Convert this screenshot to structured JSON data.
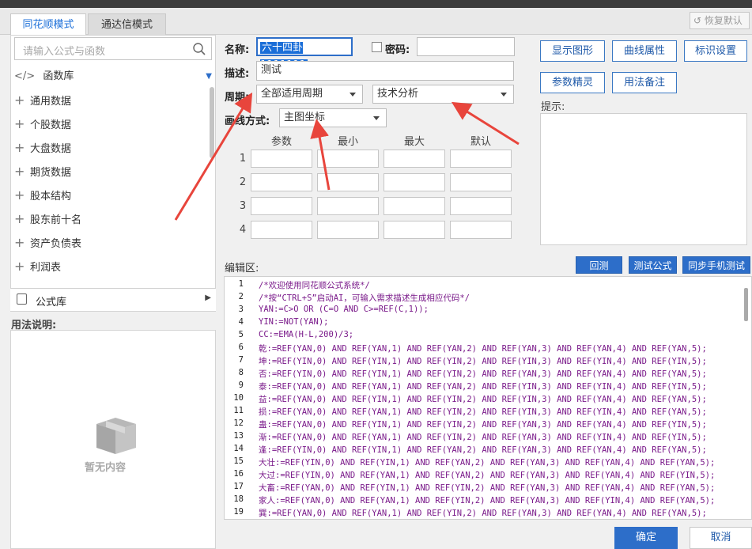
{
  "tabs": [
    {
      "label": "同花顺模式"
    },
    {
      "label": "通达信模式"
    }
  ],
  "restore_label": "恢复默认",
  "search": {
    "placeholder": "请输入公式与函数"
  },
  "func_lib": {
    "label": "函数库"
  },
  "tree": [
    {
      "label": "通用数据"
    },
    {
      "label": "个股数据"
    },
    {
      "label": "大盘数据"
    },
    {
      "label": "期货数据"
    },
    {
      "label": "股本结构"
    },
    {
      "label": "股东前十名"
    },
    {
      "label": "资产负债表"
    },
    {
      "label": "利润表"
    }
  ],
  "formula_lib": {
    "label": "公式库"
  },
  "usage": {
    "label": "用法说明:",
    "empty": "暂无内容"
  },
  "form": {
    "name_label": "名称:",
    "name_value": "六十四卦1111111",
    "password_label": "密码:",
    "desc_label": "描述:",
    "desc_value": "测试",
    "period_label": "周期:",
    "period_value": "全部适用周期",
    "category_value": "技术分析",
    "draw_label": "画线方式:",
    "draw_value": "主图坐标"
  },
  "buttons": {
    "show_graph": "显示图形",
    "curve_props": "曲线属性",
    "mark_settings": "标识设置",
    "param_wizard": "参数精灵",
    "usage_note": "用法备注",
    "backtest": "回测",
    "test_formula": "测试公式",
    "sync_mobile": "同步手机测试",
    "ok": "确定",
    "cancel": "取消"
  },
  "params": {
    "headers": [
      "参数",
      "最小",
      "最大",
      "默认"
    ],
    "rows": [
      "1",
      "2",
      "3",
      "4"
    ]
  },
  "hint_label": "提示:",
  "editor_label": "编辑区:",
  "code_lines": [
    {
      "n": "1",
      "t": "/*欢迎使用同花顺公式系统*/"
    },
    {
      "n": "2",
      "t": "/*按“CTRL+S”启动AI，可输入需求描述生成相应代码*/"
    },
    {
      "n": "3",
      "t": "YAN:=C>O OR (C=O AND C>=REF(C,1));"
    },
    {
      "n": "4",
      "t": "YIN:=NOT(YAN);"
    },
    {
      "n": "5",
      "t": "CC:=EMA(H-L,200)/3;"
    },
    {
      "n": "6",
      "t": "乾:=REF(YAN,0) AND REF(YAN,1) AND REF(YAN,2) AND REF(YAN,3) AND REF(YAN,4) AND REF(YAN,5);"
    },
    {
      "n": "7",
      "t": "坤:=REF(YIN,0) AND REF(YIN,1) AND REF(YIN,2) AND REF(YIN,3) AND REF(YIN,4) AND REF(YIN,5);"
    },
    {
      "n": "8",
      "t": "否:=REF(YIN,0) AND REF(YIN,1) AND REF(YIN,2) AND REF(YAN,3) AND REF(YAN,4) AND REF(YAN,5);"
    },
    {
      "n": "9",
      "t": "泰:=REF(YAN,0) AND REF(YAN,1) AND REF(YAN,2) AND REF(YIN,3) AND REF(YIN,4) AND REF(YIN,5);"
    },
    {
      "n": "10",
      "t": "益:=REF(YAN,0) AND REF(YIN,1) AND REF(YIN,2) AND REF(YIN,3) AND REF(YAN,4) AND REF(YAN,5);"
    },
    {
      "n": "11",
      "t": "损:=REF(YAN,0) AND REF(YAN,1) AND REF(YIN,2) AND REF(YIN,3) AND REF(YIN,4) AND REF(YAN,5);"
    },
    {
      "n": "12",
      "t": "蛊:=REF(YAN,0) AND REF(YIN,1) AND REF(YIN,2) AND REF(YAN,3) AND REF(YAN,4) AND REF(YIN,5);"
    },
    {
      "n": "13",
      "t": "渐:=REF(YAN,0) AND REF(YAN,1) AND REF(YIN,2) AND REF(YAN,3) AND REF(YIN,4) AND REF(YIN,5);"
    },
    {
      "n": "14",
      "t": "逢:=REF(YIN,0) AND REF(YIN,1) AND REF(YAN,2) AND REF(YAN,3) AND REF(YAN,4) AND REF(YAN,5);"
    },
    {
      "n": "15",
      "t": "大壮:=REF(YIN,0) AND REF(YIN,1) AND REF(YAN,2) AND REF(YAN,3) AND REF(YAN,4) AND REF(YAN,5);"
    },
    {
      "n": "16",
      "t": "大过:=REF(YIN,0) AND REF(YAN,1) AND REF(YAN,2) AND REF(YAN,3) AND REF(YAN,4) AND REF(YIN,5);"
    },
    {
      "n": "17",
      "t": "大畜:=REF(YAN,0) AND REF(YIN,1) AND REF(YIN,2) AND REF(YAN,3) AND REF(YAN,4) AND REF(YAN,5);"
    },
    {
      "n": "18",
      "t": "家人:=REF(YAN,0) AND REF(YAN,1) AND REF(YIN,2) AND REF(YAN,3) AND REF(YIN,4) AND REF(YAN,5);"
    },
    {
      "n": "19",
      "t": "巽:=REF(YAN,0) AND REF(YAN,1) AND REF(YIN,2) AND REF(YAN,3) AND REF(YAN,4) AND REF(YAN,5);"
    }
  ],
  "colors": {
    "accent": "#2d6ec9",
    "arrow": "#e8453c",
    "code": "#7a1a8a",
    "keyword": "#1a2a8a"
  }
}
